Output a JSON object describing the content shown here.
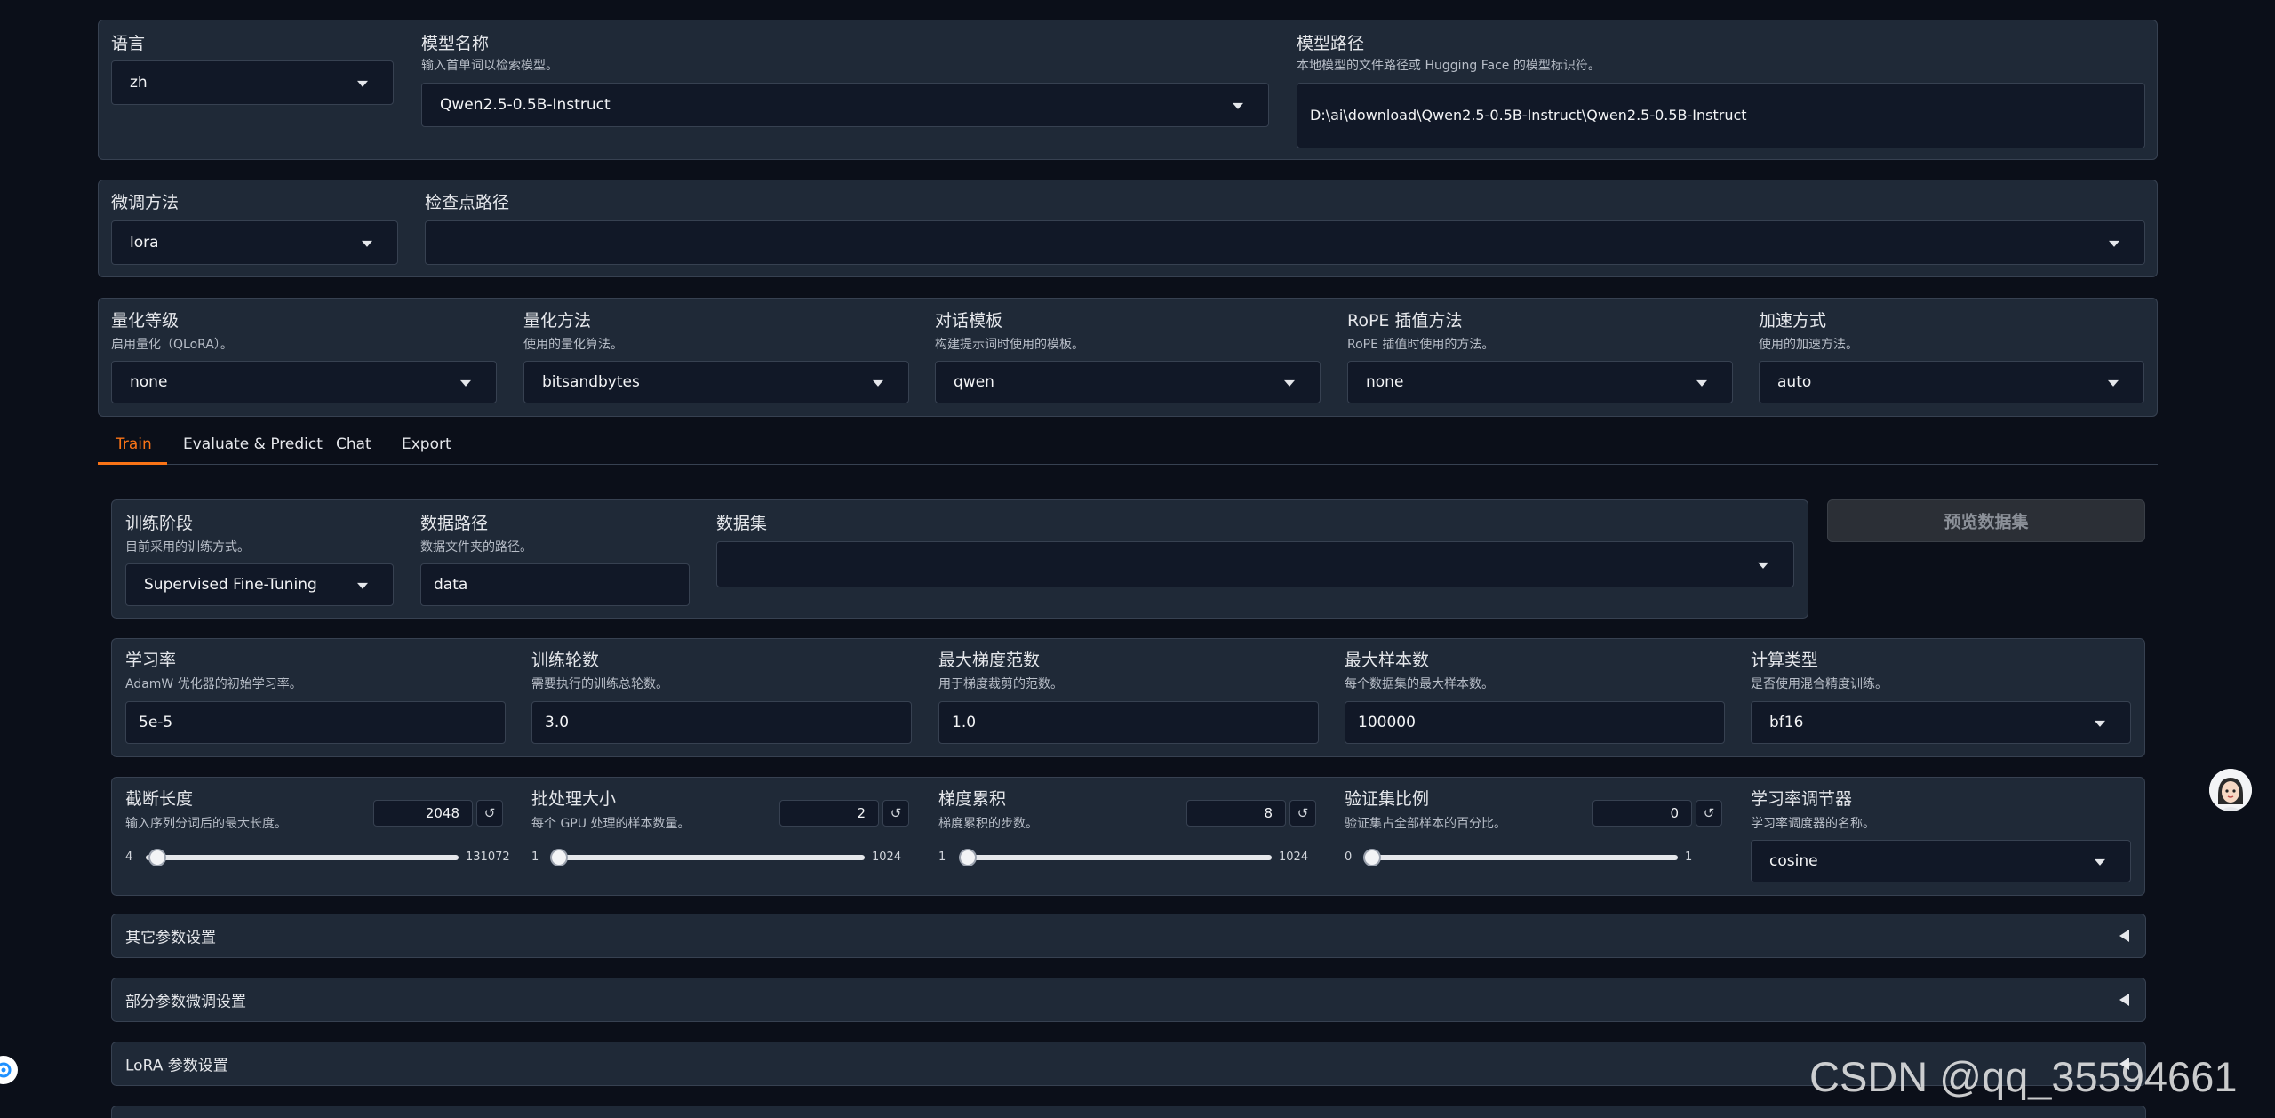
{
  "top": {
    "lang": {
      "label": "语言",
      "value": "zh"
    },
    "model_name": {
      "label": "模型名称",
      "info": "输入首单词以检索模型。",
      "value": "Qwen2.5-0.5B-Instruct"
    },
    "model_path": {
      "label": "模型路径",
      "info": "本地模型的文件路径或 Hugging Face 的模型标识符。",
      "value": "D:\\ai\\download\\Qwen2.5-0.5B-Instruct\\Qwen2.5-0.5B-Instruct"
    }
  },
  "row2": {
    "finetune": {
      "label": "微调方法",
      "value": "lora"
    },
    "checkpoint": {
      "label": "检查点路径",
      "value": ""
    }
  },
  "row3": [
    {
      "label": "量化等级",
      "info": "启用量化（QLoRA）。",
      "value": "none"
    },
    {
      "label": "量化方法",
      "info": "使用的量化算法。",
      "value": "bitsandbytes"
    },
    {
      "label": "对话模板",
      "info": "构建提示词时使用的模板。",
      "value": "qwen"
    },
    {
      "label": "RoPE 插值方法",
      "info": "RoPE 插值时使用的方法。",
      "value": "none"
    },
    {
      "label": "加速方式",
      "info": "使用的加速方法。",
      "value": "auto"
    }
  ],
  "tabs": [
    "Train",
    "Evaluate & Predict",
    "Chat",
    "Export"
  ],
  "active_tab": "Train",
  "accent_color": "#f97316",
  "train": {
    "stage": {
      "label": "训练阶段",
      "info": "目前采用的训练方式。",
      "value": "Supervised Fine-Tuning"
    },
    "data_dir": {
      "label": "数据路径",
      "info": "数据文件夹的路径。",
      "value": "data"
    },
    "dataset": {
      "label": "数据集",
      "value": ""
    },
    "preview_button": "预览数据集"
  },
  "params": [
    {
      "label": "学习率",
      "info": "AdamW 优化器的初始学习率。",
      "value": "5e-5"
    },
    {
      "label": "训练轮数",
      "info": "需要执行的训练总轮数。",
      "value": "3.0"
    },
    {
      "label": "最大梯度范数",
      "info": "用于梯度裁剪的范数。",
      "value": "1.0"
    },
    {
      "label": "最大样本数",
      "info": "每个数据集的最大样本数。",
      "value": "100000"
    },
    {
      "label": "计算类型",
      "info": "是否使用混合精度训练。",
      "value": "bf16"
    }
  ],
  "sliders": [
    {
      "label": "截断长度",
      "info": "输入序列分词后的最大长度。",
      "value": "2048",
      "min": "4",
      "max": "131072",
      "fraction": 0.0156
    },
    {
      "label": "批处理大小",
      "info": "每个 GPU 处理的样本数量。",
      "value": "2",
      "min": "1",
      "max": "1024",
      "fraction": 0.001
    },
    {
      "label": "梯度累积",
      "info": "梯度累积的步数。",
      "value": "8",
      "min": "1",
      "max": "1024",
      "fraction": 0.0068
    },
    {
      "label": "验证集比例",
      "info": "验证集占全部样本的百分比。",
      "value": "0",
      "min": "0",
      "max": "1",
      "fraction": 0.0
    }
  ],
  "scheduler": {
    "label": "学习率调节器",
    "info": "学习率调度器的名称。",
    "value": "cosine"
  },
  "reset_glyph": "↺",
  "accordions": [
    "其它参数设置",
    "部分参数微调设置",
    "LoRA 参数设置"
  ],
  "watermark": "CSDN @qq_35594661"
}
